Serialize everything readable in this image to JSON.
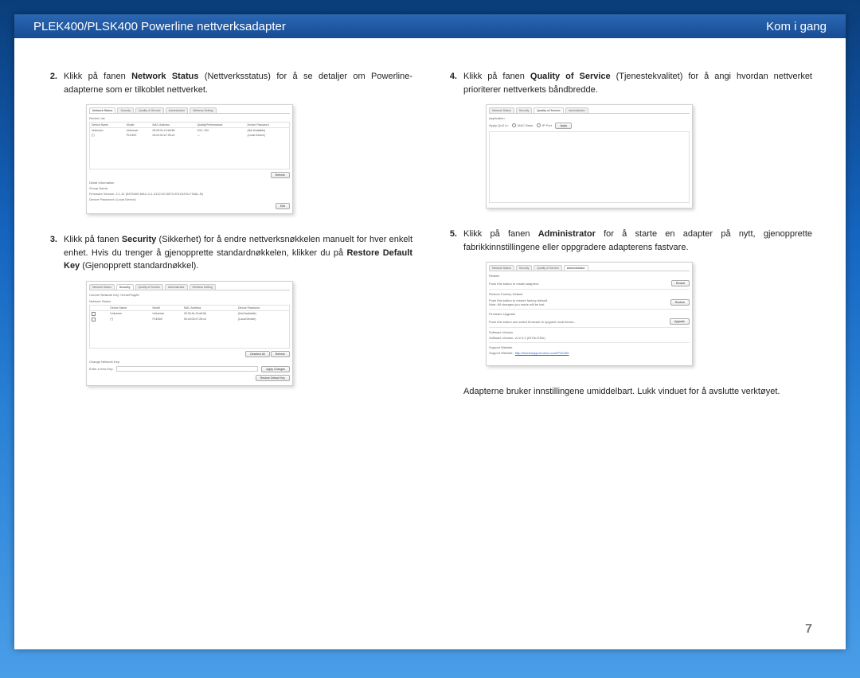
{
  "header": {
    "title_left": "PLEK400/PLSK400 Powerline nettverksadapter",
    "title_right": "Kom i gang"
  },
  "page_number": "7",
  "closing_text": "Adapterne bruker innstillingene umiddelbart. Lukk vinduet for å avslutte verktøyet.",
  "items": [
    {
      "num": "2.",
      "html": "Klikk på fanen <b>Network Status</b> (Nettverksstatus) for å se detaljer om Powerline-adapterne som er tilkoblet nettverket."
    },
    {
      "num": "3.",
      "html": "Klikk på fanen <b>Security</b> (Sikkerhet) for å endre nettverksnøkkelen manuelt for hver enkelt enhet. Hvis du trenger å gjenopprette standardnøkkelen, klikker du på <b>Restore Default Key</b> (Gjenopprett standardnøkkel)."
    },
    {
      "num": "4.",
      "html": "Klikk på fanen <b>Quality of Service</b> (Tjenestekvalitet) for å angi hvordan nettverket prioriterer nettverkets båndbredde."
    },
    {
      "num": "5.",
      "html": "Klikk på fanen <b>Administrator</b> for å starte en adapter på nytt, gjenopprette fabrikkinnstillingene eller oppgradere adapterens fastvare."
    }
  ],
  "screenshots": {
    "network_status": {
      "tabs": [
        "Network Status",
        "Security",
        "Quality of Service",
        "Administrator",
        "Wireless Setting"
      ],
      "active_tab": 0,
      "section1": "Device List",
      "headers": [
        "Device Name",
        "Model",
        "MAC Address",
        "Quality/Performance",
        "Device Password"
      ],
      "rows": [
        [
          "Unknown",
          "Unknown",
          "00:25:9c:13:e8:5b",
          "100 / 100",
          "(Not Available)"
        ],
        [
          "(*)",
          "PLE400",
          "00:c0:02:e7:25:c4",
          "---",
          "(Local Device)"
        ]
      ],
      "btn_refresh": "Refresh",
      "section2": "Detail Information",
      "detail_lines": [
        "Group Name:",
        "Firmware Version:  2.1.12 (INT6400-MAC-4-1-4122-00-3679-20101201-FINAL-B)",
        "Device Password:  (Local Device)"
      ],
      "btn_edit": "Edit"
    },
    "security": {
      "tabs": [
        "Network Status",
        "Security",
        "Quality of Service",
        "Administrator",
        "Wireless Setting"
      ],
      "active_tab": 1,
      "line_current": "Current Network Key:   HomePlugAV",
      "section_ns": "Network Status",
      "headers": [
        "",
        "Device Name",
        "Model",
        "MAC Address",
        "Device Password"
      ],
      "rows": [
        [
          "☐",
          "Unknown",
          "Unknown",
          "00:25:9c:13:e8:5b",
          "(Not Available)"
        ],
        [
          "☐",
          "(*)",
          "PLE400",
          "00:c0:02:e7:25:c4",
          "(Local Device)"
        ]
      ],
      "btn_deselect": "Deselect All",
      "btn_refresh": "Refresh",
      "section_change": "Change Network Key:",
      "label_enter": "Enter a new Key:",
      "btn_apply": "Apply Changes",
      "btn_restore": "Restore Default Key"
    },
    "qos": {
      "tabs": [
        "Network Status",
        "Security",
        "Quality of Service",
        "Administrator"
      ],
      "active_tab": 2,
      "section": "Application",
      "label_apply": "Apply QoS to:",
      "option1": "MAC Base",
      "option2": "IP Port",
      "btn_apply": "Apply"
    },
    "admin": {
      "tabs": [
        "Network Status",
        "Security",
        "Quality of Service",
        "Administrator"
      ],
      "active_tab": 3,
      "section_restart": "Restart",
      "line_restart": "Push this button to restart adapters.",
      "btn_restart": "Restart",
      "section_factory": "Restore Factory Default",
      "line_factory1": "Push this button to restore factory default.",
      "line_factory2": "Note: All changes you made will be lost.",
      "btn_restore": "Restore",
      "section_fw": "Firmware Upgrade",
      "line_fw": "Push this button and select firmware to upgrade local device.",
      "btn_upgrade": "Upgrade",
      "section_sw": "Software Version",
      "line_sw": "Software Version:   v0.2.3.2 (INT6x  ENU)",
      "section_support": "Support Website",
      "support_label": "Support Website:",
      "support_link": "http://homesupport.cisco.com/PLE400"
    }
  }
}
